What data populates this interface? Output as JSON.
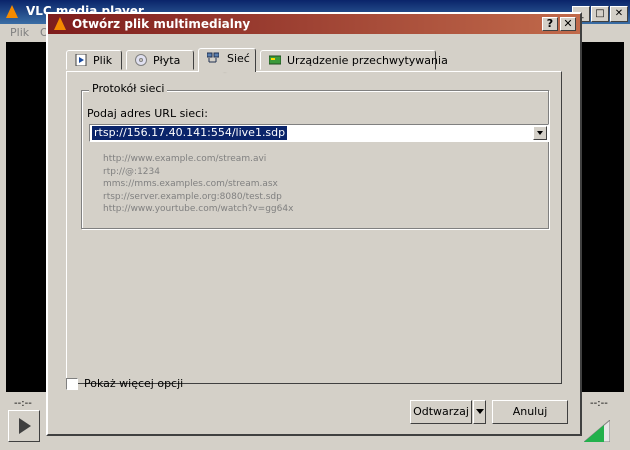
{
  "main_window": {
    "title": "VLC media player",
    "menu_file": "Plik",
    "menu_other": "O",
    "time_left": "--:--",
    "time_right": "--:--"
  },
  "dialog": {
    "title": "Otwórz plik multimedialny",
    "help_button": "?",
    "close_button": "✕",
    "tabs": [
      {
        "label": "Plik",
        "icon": "file-play-icon"
      },
      {
        "label": "Płyta",
        "icon": "disc-icon"
      },
      {
        "label": "Sieć",
        "icon": "network-icon",
        "active": true
      },
      {
        "label": "Urządzenie przechwytywania",
        "icon": "capture-card-icon"
      }
    ],
    "group_title": "Protokół sieci",
    "url_label": "Podaj adres URL sieci:",
    "url_value": "rtsp://156.17.40.141:554/live1.sdp",
    "examples": [
      "http://www.example.com/stream.avi",
      "rtp://@:1234",
      "mms://mms.examples.com/stream.asx",
      "rtsp://server.example.org:8080/test.sdp",
      "http://www.yourtube.com/watch?v=gg64x"
    ],
    "more_options_label": "Pokaż więcej opcji",
    "more_options_checked": false,
    "play_button": "Odtwarzaj",
    "cancel_button": "Anuluj"
  },
  "colors": {
    "title_gradient_start": "#7e1d1d",
    "title_gradient_end": "#c16a4b",
    "selection": "#0a246a",
    "face": "#d4d0c8"
  }
}
